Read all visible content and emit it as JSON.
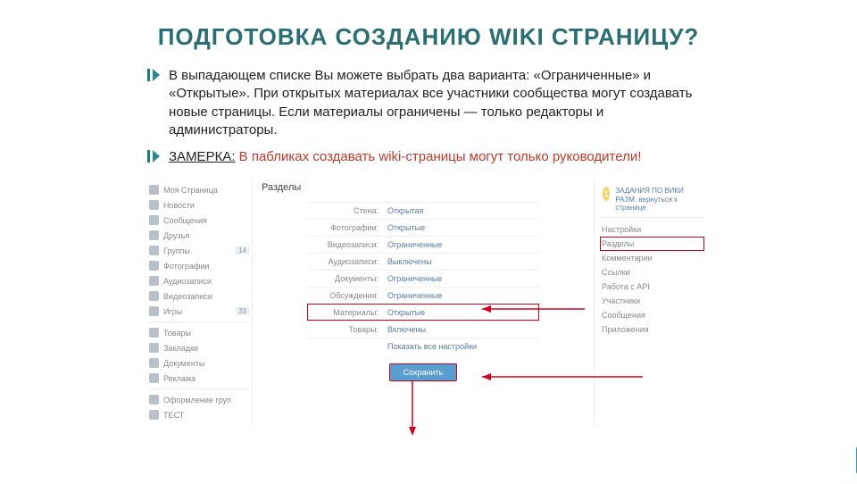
{
  "title": "ПОДГОТОВКА СОЗДАНИЮ WIKI СТРАНИЦУ?",
  "bullet1": "В выпадающем списке Вы можете выбрать два варианта: «Ограниченные» и «Открытые». При открытых материалах все участники сообщества могут создавать новые страницы. Если материалы ограничены — только редакторы и администраторы.",
  "bullet2_label": "ЗАМЕРКА:",
  "bullet2_text": " В пабликах создавать wiki-страницы могут только руководители!",
  "leftnav": [
    "Моя Страница",
    "Новости",
    "Сообщения",
    "Друзья",
    "Группы",
    "Фотографии",
    "Аудиозаписи",
    "Видеозаписи",
    "Игры"
  ],
  "leftnav_badge_groups": "14",
  "leftnav_badge_games": "33",
  "leftnav2": [
    "Товары",
    "Закладки",
    "Документы",
    "Реклама"
  ],
  "leftnav3": [
    "Оформление груп",
    "ТЕСТ"
  ],
  "sections_heading": "Разделы",
  "rows": [
    {
      "l": "Стена:",
      "v": "Открытая"
    },
    {
      "l": "Фотографии:",
      "v": "Открытые"
    },
    {
      "l": "Видеозаписи:",
      "v": "Ограниченные"
    },
    {
      "l": "Аудиозаписи:",
      "v": "Выключены"
    },
    {
      "l": "Документы:",
      "v": "Ограниченные"
    },
    {
      "l": "Обсуждения:",
      "v": "Ограниченные"
    },
    {
      "l": "Материалы:",
      "v": "Открытые"
    },
    {
      "l": "Товары:",
      "v": "Включены"
    }
  ],
  "show_all": "Показать все настройки",
  "save_btn": "Сохранить",
  "tile_num": "1",
  "tile_text": "ЗАДАНИЯ ПО ВИКИ РАЗМ. вернуться к странице",
  "rnav_top": "Настройки",
  "rnav": [
    "Разделы",
    "Комментарии",
    "Ссылки",
    "Работа с API",
    "Участники",
    "Сообщения",
    "Приложения"
  ]
}
